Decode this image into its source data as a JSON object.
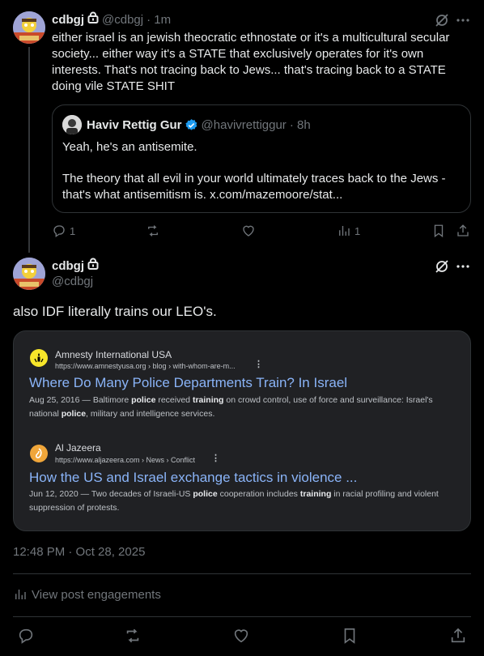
{
  "post1": {
    "author_name": "cdbgj",
    "author_handle": "@cdbgj",
    "time": "· 1m",
    "text": "either israel is an jewish theocratic ethnostate or it's a multicultural secular society... either way it's a STATE that exclusively operates for it's own interests. That's not tracing back to Jews... that's tracing back to a STATE doing vile STATE SHIT",
    "quote": {
      "author_name": "Haviv Rettig Gur",
      "author_handle": "@havivrettiggur",
      "time": "· 8h",
      "line1": "Yeah, he's an antisemite.",
      "line2": "The theory that all evil in your world ultimately traces back to the Jews - that's what antisemitism is. x.com/mazemoore/stat..."
    },
    "reply_count": "1",
    "views_count": "1"
  },
  "post2": {
    "author_name": "cdbgj",
    "author_handle": "@cdbgj",
    "text": "also IDF literally trains our LEO's.",
    "results": [
      {
        "source": "Amnesty International USA",
        "url": "https://www.amnestyusa.org › blog › with-whom-are-m...",
        "title": "Where Do Many Police Departments Train? In Israel",
        "date": "Aug 25, 2016 — ",
        "snippet_a": "Baltimore ",
        "snippet_b1": "police",
        "snippet_c": " received ",
        "snippet_b2": "training",
        "snippet_d": " on crowd control, use of force and surveillance: Israel's national ",
        "snippet_b3": "police",
        "snippet_e": ", military and intelligence services."
      },
      {
        "source": "Al Jazeera",
        "url": "https://www.aljazeera.com › News › Conflict",
        "title": "How the US and Israel exchange tactics in violence ...",
        "date": "Jun 12, 2020 — ",
        "snippet_a": "Two decades of Israeli-US ",
        "snippet_b1": "police",
        "snippet_c": " cooperation includes ",
        "snippet_b2": "training",
        "snippet_d": " in racial profiling and violent suppression of protests.",
        "snippet_b3": "",
        "snippet_e": ""
      }
    ],
    "timestamp": "12:48 PM · Oct 28, 2025",
    "engagements_label": "View post engagements"
  },
  "icons": [
    "lock-icon",
    "verified-badge-icon",
    "grok-icon",
    "more-icon",
    "reply-icon",
    "repost-icon",
    "like-icon",
    "views-icon",
    "bookmark-icon",
    "share-icon",
    "amnesty-candle-icon",
    "aljazeera-logo-icon"
  ],
  "colors": {
    "background": "#000000",
    "text": "#e7e9ea",
    "muted": "#71767b",
    "verified": "#1d9bf0",
    "link": "#8ab4f8",
    "card": "#202124"
  }
}
